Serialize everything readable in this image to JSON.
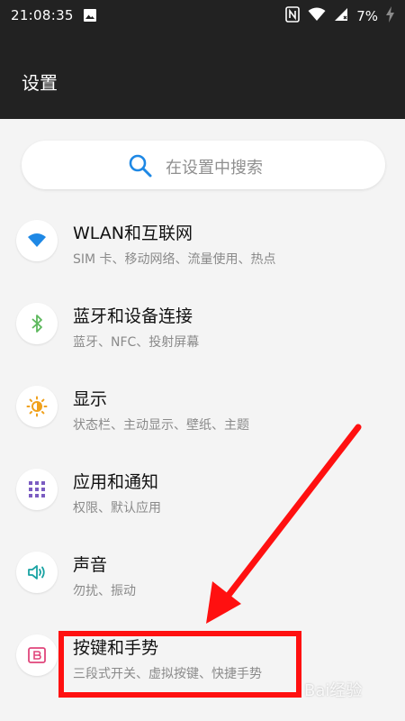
{
  "status_bar": {
    "time": "21:08:35",
    "battery_percent": "7%"
  },
  "header": {
    "title": "设置"
  },
  "search": {
    "placeholder": "在设置中搜索"
  },
  "settings_items": [
    {
      "title": "WLAN和互联网",
      "subtitle": "SIM 卡、移动网络、流量使用、热点",
      "icon": "wifi-icon",
      "icon_color": "#1e88e5"
    },
    {
      "title": "蓝牙和设备连接",
      "subtitle": "蓝牙、NFC、投射屏幕",
      "icon": "bluetooth-icon",
      "icon_color": "#5cb85c"
    },
    {
      "title": "显示",
      "subtitle": "状态栏、主动显示、壁纸、主题",
      "icon": "brightness-icon",
      "icon_color": "#f0a11c"
    },
    {
      "title": "应用和通知",
      "subtitle": "权限、默认应用",
      "icon": "apps-grid-icon",
      "icon_color": "#7b5cc2"
    },
    {
      "title": "声音",
      "subtitle": "勿扰、振动",
      "icon": "speaker-icon",
      "icon_color": "#1aa3a3"
    },
    {
      "title": "按键和手势",
      "subtitle": "三段式开关、虚拟按键、快捷手势",
      "icon": "button-b-icon",
      "icon_color": "#e0457b"
    }
  ],
  "annotation": {
    "highlight_color": "#ff1010"
  },
  "watermark": {
    "text": "Bai经验"
  }
}
